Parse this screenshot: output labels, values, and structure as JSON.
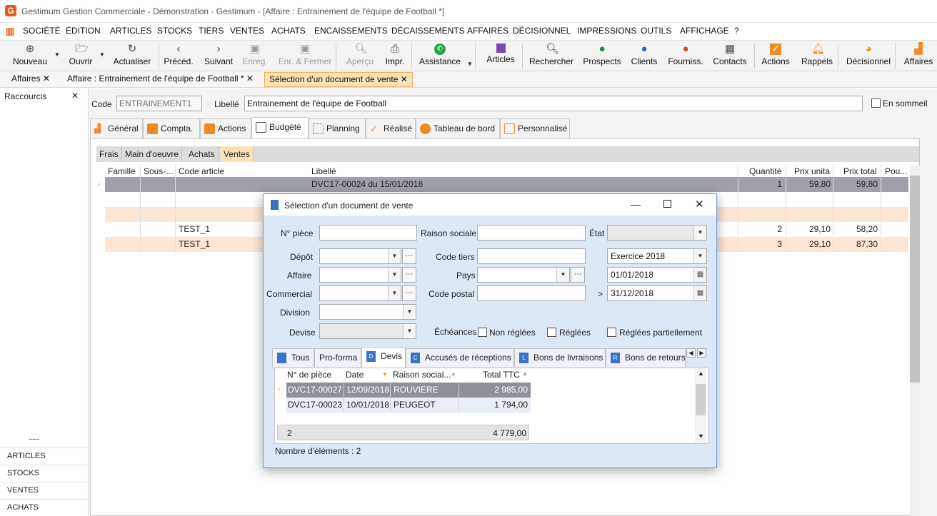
{
  "window": {
    "title": "Gestimum Gestion Commerciale - Démonstration - Gestimum - [Affaire : Entrainement de l'équipe de Football *]",
    "logo_letter": "G"
  },
  "menu": [
    "SOCIÉTÉ",
    "ÉDITION",
    "ARTICLES",
    "STOCKS",
    "TIERS",
    "VENTES",
    "ACHATS",
    "ENCAISSEMENTS",
    "DÉCAISSEMENTS",
    "AFFAIRES",
    "DÉCISIONNEL",
    "IMPRESSIONS",
    "OUTILS",
    "AFFICHAGE",
    "?"
  ],
  "toolbar": {
    "nouveau": "Nouveau",
    "ouvrir": "Ouvrir",
    "actualiser": "Actualiser",
    "preced": "Précéd.",
    "suivant": "Suivant",
    "enreg": "Enreg.",
    "enreg_fermer": "Enr. & Fermer",
    "apercu": "Aperçu",
    "impr": "Impr.",
    "assistance": "Assistance",
    "articles": "Articles",
    "rechercher": "Rechercher",
    "prospects": "Prospects",
    "clients": "Clients",
    "fourniss": "Fourniss.",
    "contacts": "Contacts",
    "actions": "Actions",
    "rappels": "Rappels",
    "decisionnel": "Décisionnel",
    "affaires": "Affaires"
  },
  "doc_tabs": [
    "Affaires",
    "Affaire : Entrainement de l'équipe de Football *",
    "Sélection d'un document de vente"
  ],
  "sidebar": {
    "header": "Raccourcis",
    "dots": "........",
    "items": [
      "ARTICLES",
      "STOCKS",
      "VENTES",
      "ACHATS"
    ]
  },
  "form": {
    "code_label": "Code",
    "code_value": "ENTRAINEMENT1",
    "libelle_label": "Libellé",
    "libelle_value": "Entrainement de l'équipe de Football",
    "sommeil_label": "En sommeil"
  },
  "page_tabs": [
    "Général",
    "Compta.",
    "Actions",
    "Budgété",
    "Planning",
    "Réalisé",
    "Tableau de bord",
    "Personnalisé"
  ],
  "sub_tabs": [
    "Frais",
    "Main d'oeuvre",
    "Achats",
    "Ventes"
  ],
  "grid": {
    "headers": [
      "Famille",
      "Sous-...",
      "Code article",
      "Libellé",
      "Quantité",
      "Prix unita",
      "Prix total",
      "Pou..."
    ],
    "rows": [
      {
        "code": "",
        "libelle": "DVC17-00024 du 15/01/2018",
        "qte": "1",
        "pu": "59,80",
        "pt": "59,80"
      },
      {
        "code": "",
        "libelle": "",
        "qte": "",
        "pu": "",
        "pt": ""
      },
      {
        "code": "",
        "libelle": "",
        "qte": "",
        "pu": "",
        "pt": ""
      },
      {
        "code": "TEST_1",
        "libelle": "",
        "qte": "2",
        "pu": "29,10",
        "pt": "58,20"
      },
      {
        "code": "TEST_1",
        "libelle": "",
        "qte": "3",
        "pu": "29,10",
        "pt": "87,30"
      }
    ]
  },
  "dialog": {
    "title": "Sélection d'un document de vente",
    "labels": {
      "piece": "N° pièce",
      "raison": "Raison sociale",
      "etat": "État",
      "depot": "Dépôt",
      "code_tiers": "Code tiers",
      "affaire": "Affaire",
      "pays": "Pays",
      "commercial": "Commercial",
      "code_postal": "Code postal",
      "division": "Division",
      "devise": "Devise",
      "echeances": "Échéances",
      "non_reglees": "Non réglées",
      "reglees": "Réglées",
      "reglees_part": "Réglées partiellement",
      "gt": ">"
    },
    "exercice": "Exercice 2018",
    "date_from": "01/01/2018",
    "date_to": "31/12/2018",
    "tabs": [
      "Tous",
      "Pro-forma",
      "Devis",
      "Accusés de réceptions",
      "Bons de livraisons",
      "Bons de retours"
    ],
    "tab_icons": [
      "D",
      "C",
      "L",
      "R"
    ],
    "grid_headers": [
      "N° de pièce",
      "Date",
      "Raison social...",
      "Total TTC"
    ],
    "rows": [
      {
        "piece": "DVC17-00027",
        "date": "12/09/2018",
        "raison": "ROUVIERE",
        "total": "2 985,00"
      },
      {
        "piece": "DVC17-00023",
        "date": "10/01/2018",
        "raison": "PEUGEOT",
        "total": "1 794,00"
      }
    ],
    "footer_count": "2",
    "footer_total": "4 779,00",
    "nb_elements": "Nombre d'éléments : 2"
  },
  "colors": {
    "accent": "#e85d1f",
    "selected_tab": "#fde2b8",
    "dialog_bg": "#dde8f6",
    "row_selected": "#8f8f99",
    "row_alt": "#fde6d6"
  }
}
